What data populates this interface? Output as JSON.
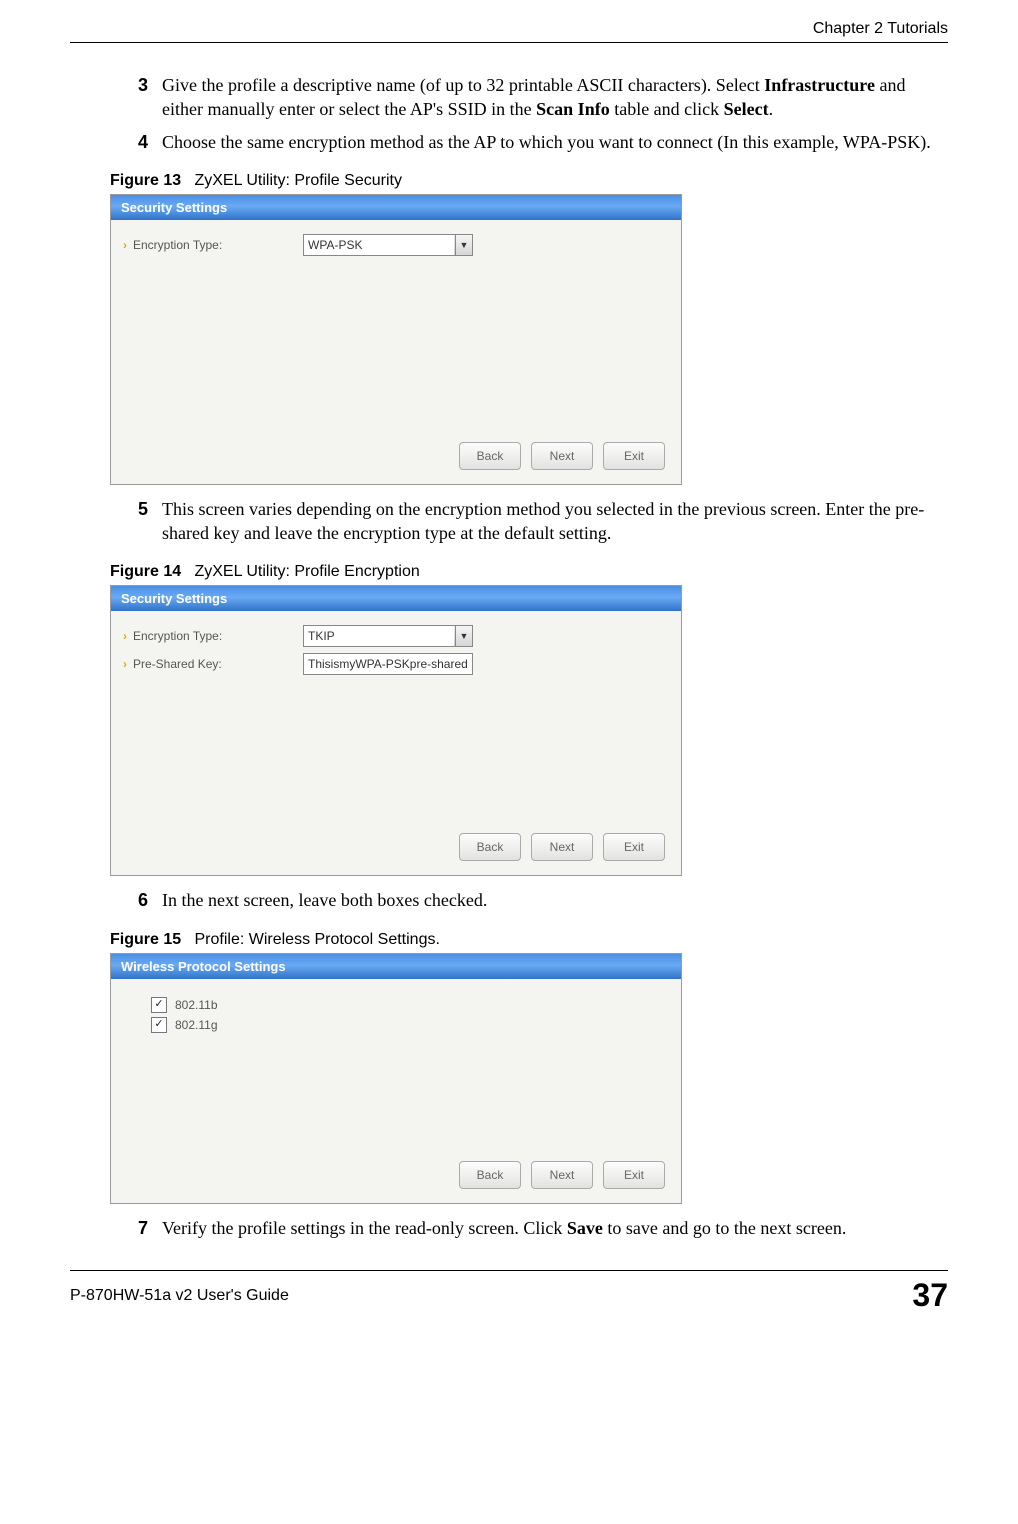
{
  "header": {
    "chapter": "Chapter 2 Tutorials"
  },
  "footer": {
    "guide": "P-870HW-51a v2 User's Guide",
    "page": "37"
  },
  "steps": {
    "s3": {
      "num": "3",
      "text_a": "Give the profile a descriptive name (of up to 32 printable ASCII characters). Select ",
      "b1": "Infrastructure",
      "text_b": " and either manually enter or select the AP's SSID in the ",
      "b2": "Scan Info",
      "text_c": " table and click ",
      "b3": "Select",
      "text_d": "."
    },
    "s4": {
      "num": "4",
      "text": "Choose the same encryption method as the AP to which you want to connect (In this example, WPA-PSK)."
    },
    "s5": {
      "num": "5",
      "text": "This screen varies depending on the encryption method you selected in the previous screen. Enter the pre-shared key and leave the encryption type at the default setting."
    },
    "s6": {
      "num": "6",
      "text": "In the next screen, leave both boxes checked."
    },
    "s7": {
      "num": "7",
      "text_a": "Verify the profile settings in the read-only screen. Click ",
      "b1": "Save",
      "text_b": " to save and go to the next screen."
    }
  },
  "figures": {
    "f13": {
      "label": "Figure 13",
      "caption": "ZyXEL Utility: Profile Security"
    },
    "f14": {
      "label": "Figure 14",
      "caption": "ZyXEL Utility: Profile Encryption"
    },
    "f15": {
      "label": "Figure 15",
      "caption": "Profile: Wireless Protocol Settings."
    }
  },
  "util": {
    "sec_title": "Security Settings",
    "wps_title": "Wireless Protocol Settings",
    "enc_type_label": "Encryption Type:",
    "psk_label": "Pre-Shared Key:",
    "enc_wpa": "WPA-PSK",
    "enc_tkip": "TKIP",
    "psk_value": "ThisismyWPA-PSKpre-sharedkey",
    "proto_b": "802.11b",
    "proto_g": "802.11g",
    "btn_back": "Back",
    "btn_next": "Next",
    "btn_exit": "Exit",
    "check": "✓"
  }
}
